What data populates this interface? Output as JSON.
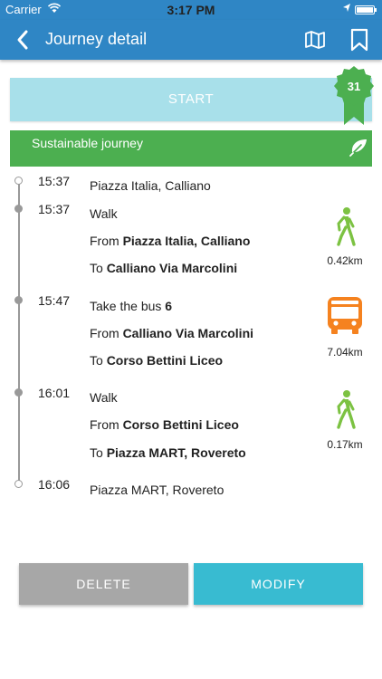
{
  "status_bar": {
    "carrier": "Carrier",
    "time": "3:17 PM"
  },
  "header": {
    "title": "Journey detail"
  },
  "start": {
    "label": "START"
  },
  "badge": {
    "count": "31"
  },
  "sustainable": {
    "label": "Sustainable journey"
  },
  "colors": {
    "header": "#2f86c5",
    "start": "#a8e0ea",
    "sustainable": "#4caf50",
    "walk": "#7cc242",
    "bus": "#f5821f",
    "delete": "#a7a7a7",
    "modify": "#38bbd1"
  },
  "steps": [
    {
      "time": "15:37",
      "place": "Piazza Italia, Calliano"
    },
    {
      "time": "15:37",
      "action": "Walk",
      "from_prefix": "From ",
      "from": "Piazza Italia, Calliano",
      "to_prefix": "To ",
      "to": "Calliano Via Marcolini",
      "distance": "0.42km",
      "icon": "walk-icon"
    },
    {
      "time": "15:47",
      "action": "Take the bus ",
      "line_number": "6",
      "from_prefix": "From ",
      "from": "Calliano Via Marcolini",
      "to_prefix": "To ",
      "to": "Corso Bettini Liceo",
      "distance": "7.04km",
      "icon": "bus-icon"
    },
    {
      "time": "16:01",
      "action": "Walk",
      "from_prefix": "From ",
      "from": "Corso Bettini Liceo",
      "to_prefix": "To ",
      "to": "Piazza MART, Rovereto",
      "distance": "0.17km",
      "icon": "walk-icon"
    },
    {
      "time": "16:06",
      "place": "Piazza MART, Rovereto"
    }
  ],
  "actions": {
    "delete": "DELETE",
    "modify": "MODIFY"
  }
}
